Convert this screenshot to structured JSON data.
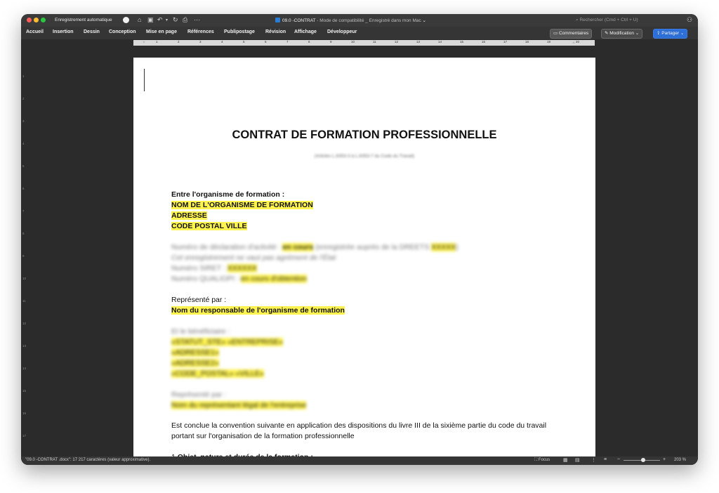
{
  "titlebar": {
    "autosave_label": "Enregistrement automatique",
    "document_name": "09.0 -CONTRAT",
    "document_subtitle": " - Mode de compatibilité _ Enregistré dans mon Mac",
    "search_placeholder": "Rechercher (Cmd + Ctrl + U)"
  },
  "ribbon": {
    "tabs": [
      "Accueil",
      "Insertion",
      "Dessin",
      "Conception",
      "Mise en page",
      "Références",
      "Publipostage",
      "Révision",
      "Affichage",
      "Développeur"
    ],
    "comments_label": "Commentaires",
    "edit_label": "Modification",
    "share_label": "Partager"
  },
  "ruler": {
    "numbers": [
      "1",
      "2",
      "3",
      "4",
      "5",
      "6",
      "7",
      "8",
      "9",
      "10",
      "11",
      "12",
      "13",
      "14",
      "15",
      "16",
      "17",
      "18",
      "19",
      "20"
    ],
    "vertical_numbers": [
      "1",
      "2",
      "3",
      "4",
      "5",
      "6",
      "7",
      "8",
      "9",
      "10",
      "11",
      "12",
      "13",
      "14",
      "15",
      "16",
      "17"
    ]
  },
  "document": {
    "title": "CONTRAT DE FORMATION PROFESSIONNELLE",
    "subtitle": "(Articles L.6353-3 à L.6353-7 du Code du Travail)",
    "between_label": "Entre l'organisme de formation :",
    "org_name": "NOM DE L'ORGANISME DE FORMATION",
    "org_address": "ADRESSE",
    "org_city": "CODE POSTAL VILLE",
    "decl_prefix": "Numéro de déclaration d'activité : ",
    "decl_status": "en cours",
    "decl_suffix": " (enregistrée auprès de la DREETS ",
    "decl_code": "XXXXX",
    "decl_close": ")",
    "decl_note": "Cet enregistrement ne vaut pas agrément de l'État",
    "siret_prefix": "Numéro SIRET : ",
    "siret_value": "XXXXXX",
    "qualiopi_prefix": "Numéro QUALIOPI : ",
    "qualiopi_value": "en cours d'obtention",
    "represented_label": "Représenté par :",
    "represented_name": "Nom du responsable de l'organisme de formation",
    "beneficiary_label": "Et le bénéficiaire :",
    "beneficiary_company": "«STATUT_STE» «ENTREPRISE»",
    "beneficiary_address1": "«ADRESSE1»",
    "beneficiary_address2": "«ADRESSE2»",
    "beneficiary_city": "«CODE_POSTAL» «VILLE»",
    "beneficiary_rep_label": "Représenté par :",
    "beneficiary_rep_name": "Nom du représentant légal de l'entreprise",
    "convention_line1": "Est conclue la convention suivante en application des dispositions du livre III de la sixième partie du code du travail",
    "convention_line2": "portant sur l'organisation de la formation professionnelle",
    "section1_number": "1.",
    "section1_title": "Objet, nature et durée de la formation :"
  },
  "statusbar": {
    "word_count": "\"09.0 -CONTRAT .docx\": 17 217 caractères (valeur approximative).",
    "focus_label": "Focus",
    "zoom_percent": "203 %",
    "zoom_level": 0.54
  }
}
